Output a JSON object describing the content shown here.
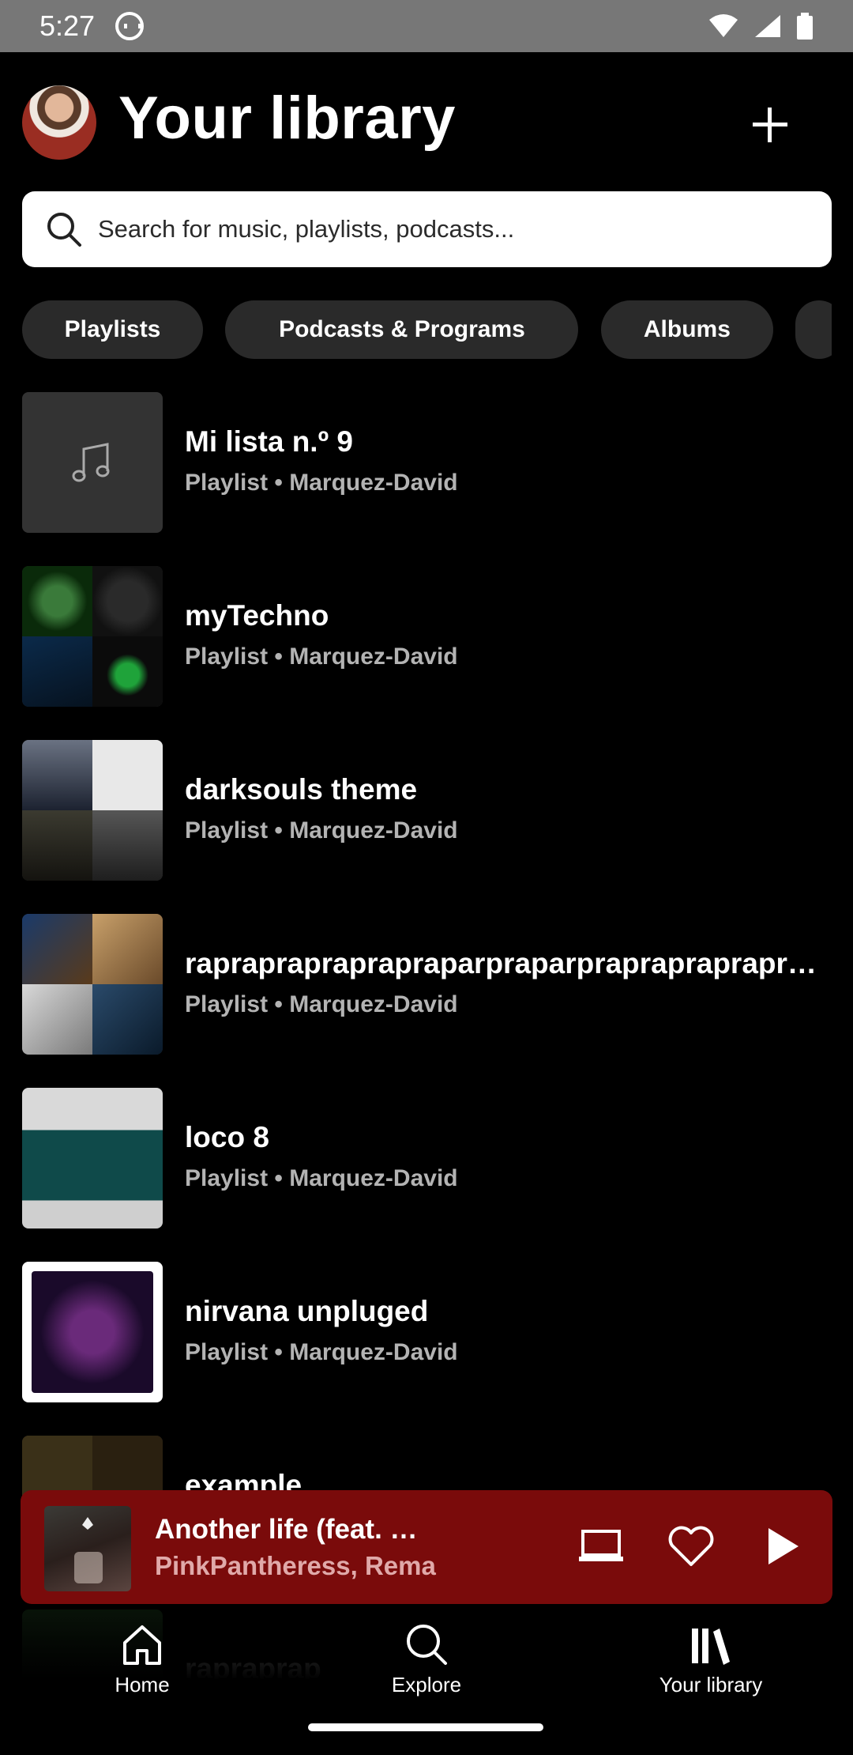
{
  "status_bar": {
    "time": "5:27"
  },
  "header": {
    "title": "Your library"
  },
  "search": {
    "placeholder": "Search for music, playlists, podcasts..."
  },
  "filters": [
    {
      "label": "Playlists"
    },
    {
      "label": "Podcasts & Programs"
    },
    {
      "label": "Albums"
    }
  ],
  "library": [
    {
      "title": "Mi lista n.º 9",
      "subtitle": "Playlist • Marquez-David"
    },
    {
      "title": "myTechno",
      "subtitle": "Playlist • Marquez-David"
    },
    {
      "title": "darksouls theme",
      "subtitle": "Playlist • Marquez-David"
    },
    {
      "title": "rapraprapraprapraparpraparprapraprapraprap",
      "subtitle": "Playlist • Marquez-David"
    },
    {
      "title": "loco 8",
      "subtitle": "Playlist • Marquez-David"
    },
    {
      "title": "nirvana unpluged",
      "subtitle": "Playlist • Marquez-David"
    },
    {
      "title": "example",
      "subtitle": ""
    },
    {
      "title": "rapraprap",
      "subtitle": ""
    }
  ],
  "now_playing": {
    "title": "Another life (feat. …",
    "artist": "PinkPantheress, Rema",
    "background_color": "#7a0b0b"
  },
  "nav": {
    "home": "Home",
    "explore": "Explore",
    "library": "Your library"
  },
  "colors": {
    "background": "#000000",
    "chip": "#2a2a2a",
    "secondary_text": "#b3b3b3"
  }
}
